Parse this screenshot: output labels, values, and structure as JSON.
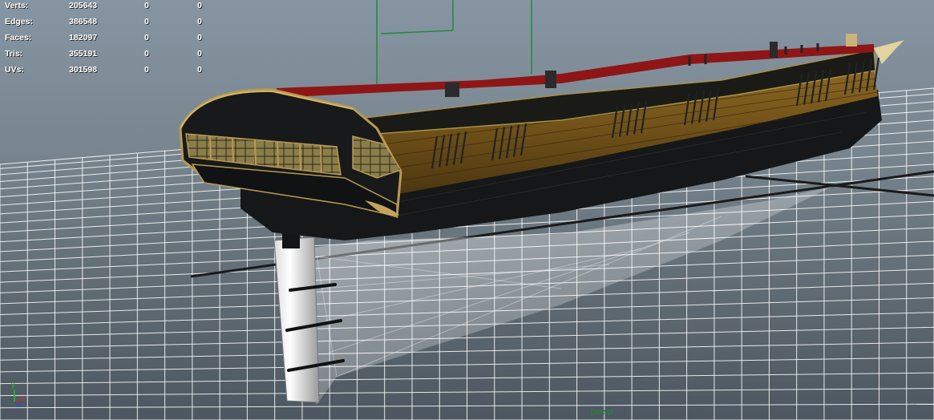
{
  "heads_up_display": {
    "stats": [
      {
        "label": "Verts:",
        "values": [
          "205643",
          "0",
          "0"
        ]
      },
      {
        "label": "Edges:",
        "values": [
          "386548",
          "0",
          "0"
        ]
      },
      {
        "label": "Faces:",
        "values": [
          "182097",
          "0",
          "0"
        ]
      },
      {
        "label": "Tris:",
        "values": [
          "355191",
          "0",
          "0"
        ]
      },
      {
        "label": "UVs:",
        "values": [
          "301598",
          "0",
          "0"
        ]
      }
    ]
  },
  "viewport": {
    "camera_name": "persp",
    "axis_labels": {
      "y": "y",
      "x": "x",
      "z": "z"
    }
  },
  "colors": {
    "background_top": "#8795a3",
    "background_bottom": "#4c5761",
    "grid_line": "#ffffff",
    "grid_axis": "#1a1a1a",
    "hull_wood": "#7a5a1c",
    "hull_dark": "#1a1c1d",
    "deck_red": "#8e1616",
    "gold_trim": "#b79a52",
    "selection_green": "#1f8a3a",
    "axis_x": "#e02020",
    "axis_y": "#20c020",
    "axis_z": "#2050e0"
  }
}
